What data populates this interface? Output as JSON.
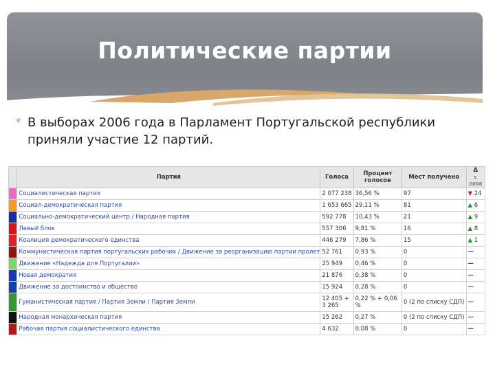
{
  "slide": {
    "title": "Политические партии",
    "bullet": "В выборах 2006 года в Парламент Португальской республики приняли участие 12 партий."
  },
  "table": {
    "headers": {
      "party": "Партия",
      "votes": "Голоса",
      "percent": "Процент голосов",
      "seats": "Мест получено",
      "delta": "Δ",
      "delta_sub": "с 2006"
    },
    "rows": [
      {
        "color": "#f06ac3",
        "name": "Социалистическая партия",
        "votes": "2 077 238",
        "percent": "36,56 %",
        "seats": "97",
        "dir": "▼",
        "dir_type": "down",
        "delta": "24"
      },
      {
        "color": "#f59b22",
        "name": "Социал-демократическая партия",
        "votes": "1 653 665",
        "percent": "29,11 %",
        "seats": "81",
        "dir": "▲",
        "dir_type": "up",
        "delta": "6"
      },
      {
        "color": "#1b2f9c",
        "name": "Социально-демократический центр / Народная партия",
        "votes": "592 778",
        "percent": "10,43 %",
        "seats": "21",
        "dir": "▲",
        "dir_type": "up",
        "delta": "9"
      },
      {
        "color": "#d6151b",
        "name": "Левый блок",
        "votes": "557 306",
        "percent": "9,81 %",
        "seats": "16",
        "dir": "▲",
        "dir_type": "up",
        "delta": "8"
      },
      {
        "color": "#e11f26",
        "name": "Коалиция демократического единства",
        "votes": "446 279",
        "percent": "7,86 %",
        "seats": "15",
        "dir": "▲",
        "dir_type": "up",
        "delta": "1"
      },
      {
        "color": "#8b1414",
        "name": "Коммунистическая партия португальских рабочих / Движение за реорганизацию партии пролетариата",
        "votes": "52 761",
        "percent": "0,93 %",
        "seats": "0",
        "dir": "",
        "dir_type": "none",
        "delta": "—"
      },
      {
        "color": "#7fd36f",
        "name": "Движение «Надежда для Португалии»",
        "votes": "25 949",
        "percent": "0,46 %",
        "seats": "0",
        "dir": "",
        "dir_type": "none",
        "delta": "—"
      },
      {
        "color": "#1f35b8",
        "name": "Новая демократия",
        "votes": "21 876",
        "percent": "0,38 %",
        "seats": "0",
        "dir": "",
        "dir_type": "none",
        "delta": "—"
      },
      {
        "color": "#1642a8",
        "name": "Движение за достоинство и общество",
        "votes": "15 924",
        "percent": "0,28 %",
        "seats": "0",
        "dir": "",
        "dir_type": "none",
        "delta": "—"
      },
      {
        "color": "#2f9a2f",
        "name": "Гуманистическая партия / Партия Земли / Партия Земли",
        "votes": "12 405 + 3 265",
        "percent": "0,22 % + 0,06 %",
        "seats": "0 (2 по списку СДП)",
        "dir": "",
        "dir_type": "none",
        "delta": "—",
        "tall": true
      },
      {
        "color": "#111111",
        "name": "Народная монархическая партия",
        "votes": "15 262",
        "percent": "0,27 %",
        "seats": "0 (2 по списку СДП)",
        "dir": "",
        "dir_type": "none",
        "delta": "—"
      },
      {
        "color": "#b31818",
        "name": "Рабочая партия социалистического единства",
        "votes": "4 632",
        "percent": "0,08 %",
        "seats": "0",
        "dir": "",
        "dir_type": "none",
        "delta": "—"
      }
    ]
  }
}
